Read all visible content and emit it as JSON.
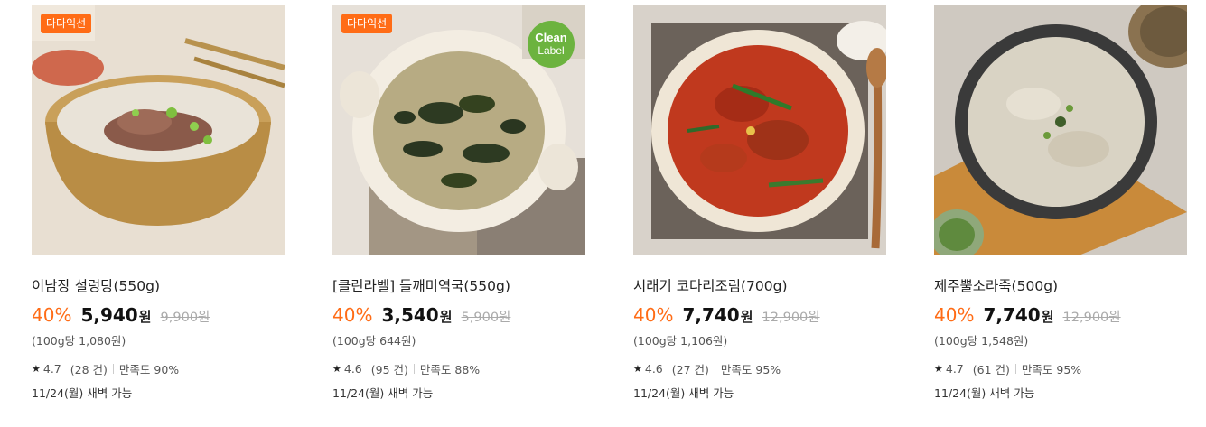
{
  "products": [
    {
      "badge": "다다익선",
      "name": "이남장 설렁탕(550g)",
      "discount": "40%",
      "price": "5,940",
      "won": "원",
      "original": "9,900원",
      "unit_price": "(100g당 1,080원)",
      "rating": "4.7",
      "reviews": "(28 건)",
      "satisfaction": "만족도 90%",
      "delivery": "11/24(월) 새벽 가능"
    },
    {
      "badge": "다다익선",
      "clean_label_1": "Clean",
      "clean_label_2": "Label",
      "name": "[클린라벨] 들깨미역국(550g)",
      "discount": "40%",
      "price": "3,540",
      "won": "원",
      "original": "5,900원",
      "unit_price": "(100g당 644원)",
      "rating": "4.6",
      "reviews": "(95 건)",
      "satisfaction": "만족도 88%",
      "delivery": "11/24(월) 새벽 가능"
    },
    {
      "name": "시래기 코다리조림(700g)",
      "discount": "40%",
      "price": "7,740",
      "won": "원",
      "original": "12,900원",
      "unit_price": "(100g당 1,106원)",
      "rating": "4.6",
      "reviews": "(27 건)",
      "satisfaction": "만족도 95%",
      "delivery": "11/24(월) 새벽 가능"
    },
    {
      "name": "제주뿔소라죽(500g)",
      "discount": "40%",
      "price": "7,740",
      "won": "원",
      "original": "12,900원",
      "unit_price": "(100g당 1,548원)",
      "rating": "4.7",
      "reviews": "(61 건)",
      "satisfaction": "만족도 95%",
      "delivery": "11/24(월) 새벽 가능"
    }
  ],
  "star_glyph": "★",
  "colors": {
    "accent": "#ff6c16",
    "clean_label": "#6cb33f"
  }
}
